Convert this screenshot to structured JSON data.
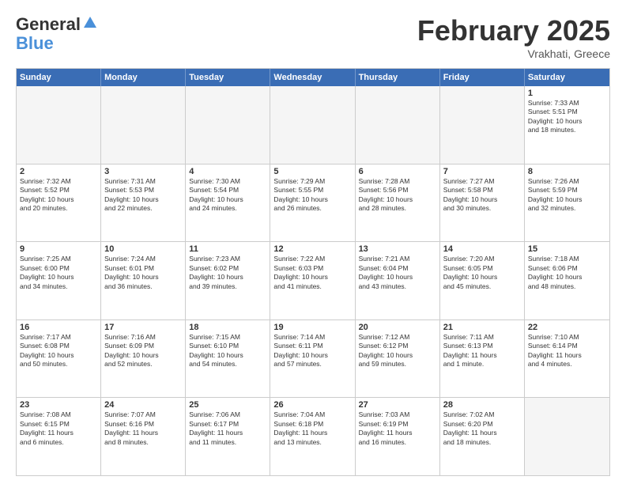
{
  "header": {
    "logo_general": "General",
    "logo_blue": "Blue",
    "month_year": "February 2025",
    "location": "Vrakhati, Greece"
  },
  "weekdays": [
    "Sunday",
    "Monday",
    "Tuesday",
    "Wednesday",
    "Thursday",
    "Friday",
    "Saturday"
  ],
  "rows": [
    [
      {
        "day": "",
        "empty": true
      },
      {
        "day": "",
        "empty": true
      },
      {
        "day": "",
        "empty": true
      },
      {
        "day": "",
        "empty": true
      },
      {
        "day": "",
        "empty": true
      },
      {
        "day": "",
        "empty": true
      },
      {
        "day": "1",
        "info": "Sunrise: 7:33 AM\nSunset: 5:51 PM\nDaylight: 10 hours\nand 18 minutes."
      }
    ],
    [
      {
        "day": "2",
        "info": "Sunrise: 7:32 AM\nSunset: 5:52 PM\nDaylight: 10 hours\nand 20 minutes."
      },
      {
        "day": "3",
        "info": "Sunrise: 7:31 AM\nSunset: 5:53 PM\nDaylight: 10 hours\nand 22 minutes."
      },
      {
        "day": "4",
        "info": "Sunrise: 7:30 AM\nSunset: 5:54 PM\nDaylight: 10 hours\nand 24 minutes."
      },
      {
        "day": "5",
        "info": "Sunrise: 7:29 AM\nSunset: 5:55 PM\nDaylight: 10 hours\nand 26 minutes."
      },
      {
        "day": "6",
        "info": "Sunrise: 7:28 AM\nSunset: 5:56 PM\nDaylight: 10 hours\nand 28 minutes."
      },
      {
        "day": "7",
        "info": "Sunrise: 7:27 AM\nSunset: 5:58 PM\nDaylight: 10 hours\nand 30 minutes."
      },
      {
        "day": "8",
        "info": "Sunrise: 7:26 AM\nSunset: 5:59 PM\nDaylight: 10 hours\nand 32 minutes."
      }
    ],
    [
      {
        "day": "9",
        "info": "Sunrise: 7:25 AM\nSunset: 6:00 PM\nDaylight: 10 hours\nand 34 minutes."
      },
      {
        "day": "10",
        "info": "Sunrise: 7:24 AM\nSunset: 6:01 PM\nDaylight: 10 hours\nand 36 minutes."
      },
      {
        "day": "11",
        "info": "Sunrise: 7:23 AM\nSunset: 6:02 PM\nDaylight: 10 hours\nand 39 minutes."
      },
      {
        "day": "12",
        "info": "Sunrise: 7:22 AM\nSunset: 6:03 PM\nDaylight: 10 hours\nand 41 minutes."
      },
      {
        "day": "13",
        "info": "Sunrise: 7:21 AM\nSunset: 6:04 PM\nDaylight: 10 hours\nand 43 minutes."
      },
      {
        "day": "14",
        "info": "Sunrise: 7:20 AM\nSunset: 6:05 PM\nDaylight: 10 hours\nand 45 minutes."
      },
      {
        "day": "15",
        "info": "Sunrise: 7:18 AM\nSunset: 6:06 PM\nDaylight: 10 hours\nand 48 minutes."
      }
    ],
    [
      {
        "day": "16",
        "info": "Sunrise: 7:17 AM\nSunset: 6:08 PM\nDaylight: 10 hours\nand 50 minutes."
      },
      {
        "day": "17",
        "info": "Sunrise: 7:16 AM\nSunset: 6:09 PM\nDaylight: 10 hours\nand 52 minutes."
      },
      {
        "day": "18",
        "info": "Sunrise: 7:15 AM\nSunset: 6:10 PM\nDaylight: 10 hours\nand 54 minutes."
      },
      {
        "day": "19",
        "info": "Sunrise: 7:14 AM\nSunset: 6:11 PM\nDaylight: 10 hours\nand 57 minutes."
      },
      {
        "day": "20",
        "info": "Sunrise: 7:12 AM\nSunset: 6:12 PM\nDaylight: 10 hours\nand 59 minutes."
      },
      {
        "day": "21",
        "info": "Sunrise: 7:11 AM\nSunset: 6:13 PM\nDaylight: 11 hours\nand 1 minute."
      },
      {
        "day": "22",
        "info": "Sunrise: 7:10 AM\nSunset: 6:14 PM\nDaylight: 11 hours\nand 4 minutes."
      }
    ],
    [
      {
        "day": "23",
        "info": "Sunrise: 7:08 AM\nSunset: 6:15 PM\nDaylight: 11 hours\nand 6 minutes."
      },
      {
        "day": "24",
        "info": "Sunrise: 7:07 AM\nSunset: 6:16 PM\nDaylight: 11 hours\nand 8 minutes."
      },
      {
        "day": "25",
        "info": "Sunrise: 7:06 AM\nSunset: 6:17 PM\nDaylight: 11 hours\nand 11 minutes."
      },
      {
        "day": "26",
        "info": "Sunrise: 7:04 AM\nSunset: 6:18 PM\nDaylight: 11 hours\nand 13 minutes."
      },
      {
        "day": "27",
        "info": "Sunrise: 7:03 AM\nSunset: 6:19 PM\nDaylight: 11 hours\nand 16 minutes."
      },
      {
        "day": "28",
        "info": "Sunrise: 7:02 AM\nSunset: 6:20 PM\nDaylight: 11 hours\nand 18 minutes."
      },
      {
        "day": "",
        "empty": true
      }
    ]
  ]
}
